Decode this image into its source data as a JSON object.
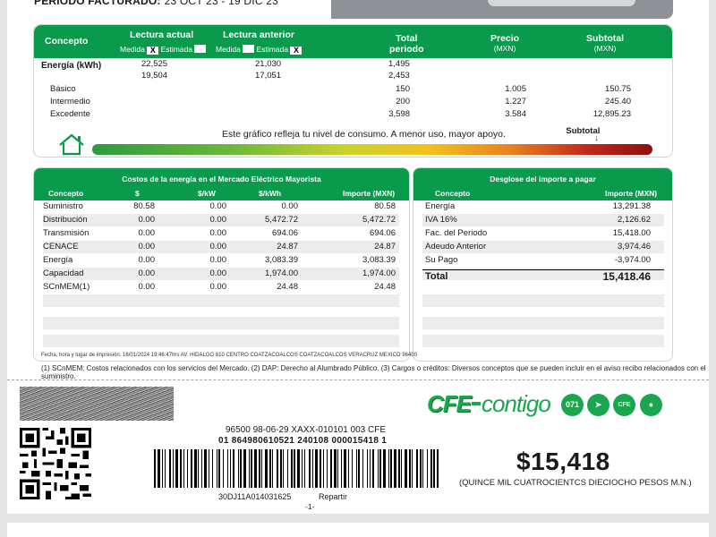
{
  "header": {
    "period_label": "PERIODO FACTURADO:",
    "period_value": "23 OCT 23 - 19 DIC 23"
  },
  "consumo": {
    "headers": {
      "concepto": "Concepto",
      "lectura_actual": "Lectura actual",
      "lectura_anterior": "Lectura anterior",
      "total_periodo": "Total\nperiodo",
      "total_l1": "Total",
      "total_l2": "periodo",
      "precio": "Precio",
      "precio_unit": "(MXN)",
      "subtotal": "Subtotal",
      "subtotal_unit": "(MXN)",
      "medida": "Medida",
      "estimada": "Estimada",
      "actual_medida_mark": "X",
      "anterior_estimada_mark": "X"
    },
    "energia_label": "Energía (kWh)",
    "readings": [
      {
        "actual": "22,525",
        "anterior": "21,030",
        "total": "1,495"
      },
      {
        "actual": "19,504",
        "anterior": "17,051",
        "total": "2,453"
      }
    ],
    "tiers": [
      {
        "name": "Básico",
        "total": "150",
        "precio": "1.005",
        "subtotal": "150.75"
      },
      {
        "name": "Intermedio",
        "total": "200",
        "precio": "1.227",
        "subtotal": "245.40"
      },
      {
        "name": "Excedente",
        "total": "3,598",
        "precio": "3.584",
        "subtotal": "12,895.23"
      }
    ],
    "gauge_text": "Este gráfico refleja tu nivel de consumo. A menor uso, mayor apoyo.",
    "gauge_marker_label": "Subtotal",
    "gauge_marker_arrow": "↓",
    "gauge_level_fraction": 0.9
  },
  "costos": {
    "title": "Costos de la energía en el Mercado Eléctrico Mayorista",
    "columns": [
      "Concepto",
      "$",
      "$/kW",
      "$/kWh",
      "Importe (MXN)"
    ],
    "rows": [
      [
        "Suministro",
        "80.58",
        "0.00",
        "0.00",
        "80.58"
      ],
      [
        "Distribución",
        "0.00",
        "0.00",
        "5,472.72",
        "5,472.72"
      ],
      [
        "Transmisión",
        "0.00",
        "0.00",
        "694.06",
        "694.06"
      ],
      [
        "CENACE",
        "0.00",
        "0.00",
        "24.87",
        "24.87"
      ],
      [
        "Energía",
        "0.00",
        "0.00",
        "3,083.39",
        "3,083.39"
      ],
      [
        "Capacidad",
        "0.00",
        "0.00",
        "1,974.00",
        "1,974.00"
      ],
      [
        "SCnMEM(1)",
        "0.00",
        "0.00",
        "24.48",
        "24.48"
      ]
    ]
  },
  "desglose": {
    "title": "Desglose del importe a pagar",
    "columns": [
      "Concepto",
      "Importe (MXN)"
    ],
    "rows": [
      [
        "Energía",
        "13,291.38"
      ],
      [
        "IVA 16%",
        "2,126.62"
      ],
      [
        "Fac. del Periodo",
        "15,418.00"
      ],
      [
        "Adeudo Anterior",
        "3,974.46"
      ],
      [
        "Su Pago",
        "-3,974.00"
      ]
    ],
    "total_label": "Total",
    "total_value": "15,418.46"
  },
  "print_info": "Fecha, hora y lugar de impresión: 16/01/2024 19:46:47hrs AV. HIDALGO 810  CENTRO COATZACOALCOS COATZACOALCOS VERACRUZ MEXICO 96400",
  "footnote": "(1) SCnMEM: Costos relacionados con los servicios del Mercado. (2) DAP: Derecho al Alumbrado Público. (3) Cargos o créditos: Diversos conceptos que se pueden incluir en el aviso recibo relacionados con el suministro.",
  "brand": {
    "cfe": "CFE",
    "contigo": "contigo",
    "icons": [
      {
        "name": "071",
        "label": "071"
      },
      {
        "name": "telegram",
        "label": "➤"
      },
      {
        "name": "cfe-app",
        "label": "CFE"
      },
      {
        "name": "location",
        "label": "●"
      }
    ],
    "accent_color": "#0a9a4c"
  },
  "payment": {
    "ref_line1": "96500 98-06-29 XAXX-010101 003 CFE",
    "ref_line2": "01 864980610521 240108 000015418 1",
    "barcode_caption": "30DJ11A014031625",
    "repartir": "Repartir",
    "page": "-1-",
    "amount": "$15,418",
    "amount_words": "(QUINCE MIL CUATROCIENTCS DIECIOCHO PESOS  M.N.)"
  }
}
